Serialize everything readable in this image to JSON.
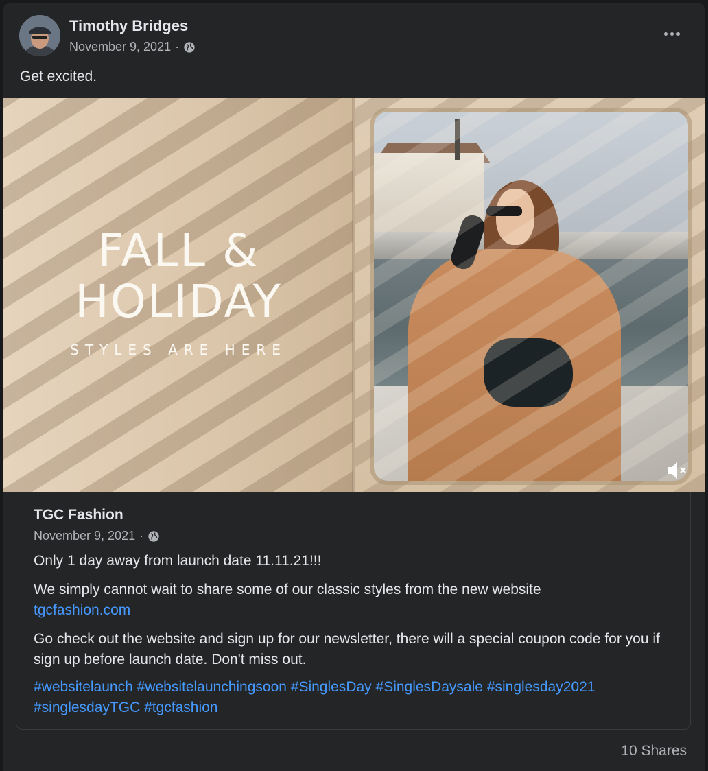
{
  "post": {
    "author": "Timothy Bridges",
    "date": "November 9, 2021",
    "separator": "·",
    "text": "Get excited.",
    "shares": "10 Shares"
  },
  "media": {
    "headline_line1": "FALL &",
    "headline_line2": "HOLIDAY",
    "headline_sub": "STYLES ARE HERE",
    "icon": "volume-muted-icon"
  },
  "shared": {
    "page_name": "TGC Fashion",
    "date": "November 9, 2021",
    "separator": "·",
    "line1": "Only 1 day away from launch date 11.11.21!!!",
    "line2": "We simply cannot wait to share some of our classic styles from the new website",
    "link": "tgcfashion.com",
    "line3": "Go check out the website and  sign up for our newsletter, there will a special coupon code for you if sign up before launch date. Don't miss out.",
    "hashtags": [
      "#websitelaunch",
      "#websitelaunchingsoon",
      "#SinglesDay",
      "#SinglesDaysale",
      "#singlesday2021",
      "#singlesdayTGC",
      "#tgcfashion"
    ]
  },
  "colors": {
    "background": "#242526",
    "link": "#4599ff",
    "text_primary": "#e4e6eb",
    "text_secondary": "#b0b3b8"
  }
}
